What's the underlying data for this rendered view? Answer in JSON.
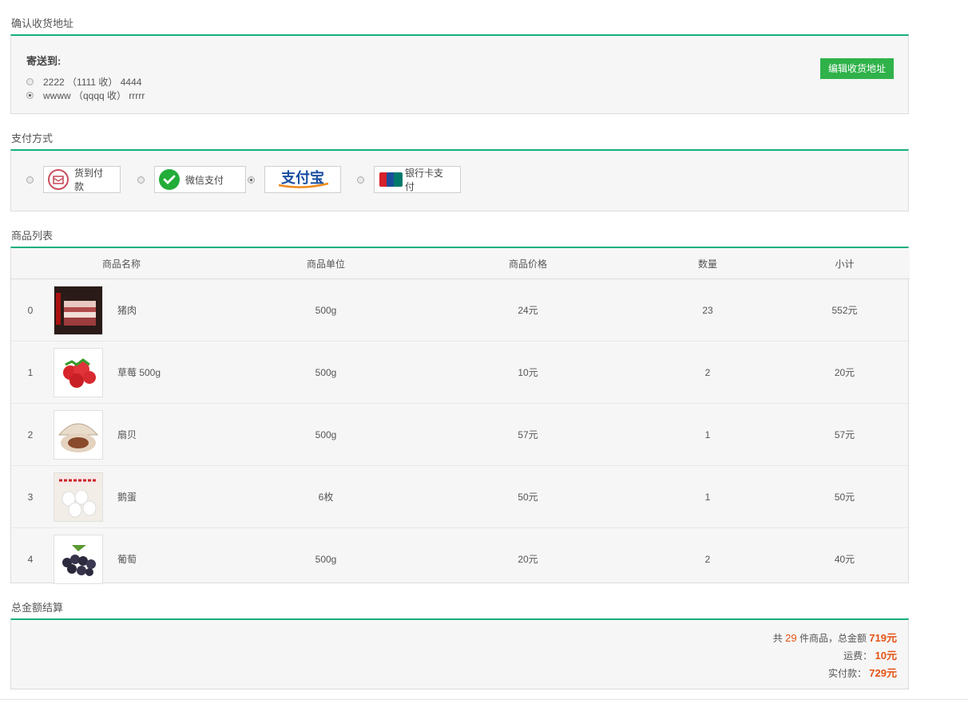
{
  "address_section": {
    "title": "确认收货地址",
    "ship_to_label": "寄送到:",
    "addresses": [
      {
        "text": "2222 （1111 收） 4444",
        "selected": false
      },
      {
        "text": "wwww （qqqq 收） rrrrr",
        "selected": true
      }
    ],
    "edit_button": "编辑收货地址"
  },
  "payment_section": {
    "title": "支付方式",
    "methods": [
      {
        "label": "货到付款",
        "icon": "cash-on-delivery-icon",
        "selected": false
      },
      {
        "label": "微信支付",
        "icon": "wechat-pay-icon",
        "selected": false
      },
      {
        "label": "支付宝",
        "icon": "alipay-logo",
        "selected": true
      },
      {
        "label": "银行卡支付",
        "icon": "unionpay-icon",
        "selected": false
      }
    ]
  },
  "goods_section": {
    "title": "商品列表",
    "columns": [
      "商品名称",
      "商品单位",
      "商品价格",
      "数量",
      "小计"
    ],
    "rows": [
      {
        "index": "0",
        "name": "猪肉",
        "unit": "500g",
        "price": "24元",
        "qty": "23",
        "subtotal": "552元",
        "image": "pork-image"
      },
      {
        "index": "1",
        "name": "草莓 500g",
        "unit": "500g",
        "price": "10元",
        "qty": "2",
        "subtotal": "20元",
        "image": "strawberry-image"
      },
      {
        "index": "2",
        "name": "扇贝",
        "unit": "500g",
        "price": "57元",
        "qty": "1",
        "subtotal": "57元",
        "image": "scallop-image"
      },
      {
        "index": "3",
        "name": "鹅蛋",
        "unit": "6枚",
        "price": "50元",
        "qty": "1",
        "subtotal": "50元",
        "image": "goose-egg-image"
      },
      {
        "index": "4",
        "name": "葡萄",
        "unit": "500g",
        "price": "20元",
        "qty": "2",
        "subtotal": "40元",
        "image": "grape-image"
      }
    ]
  },
  "total_section": {
    "title": "总金额结算",
    "line1_prefix": "共",
    "item_count": "29",
    "line1_middle": "件商品，总金额",
    "total_amount": "719元",
    "shipping_label": "运费：",
    "shipping_amount": "10元",
    "paid_label": "实付款：",
    "paid_amount": "729元"
  },
  "colors": {
    "accent": "#17b07c",
    "button": "#2fb24a",
    "price": "#e45315"
  }
}
